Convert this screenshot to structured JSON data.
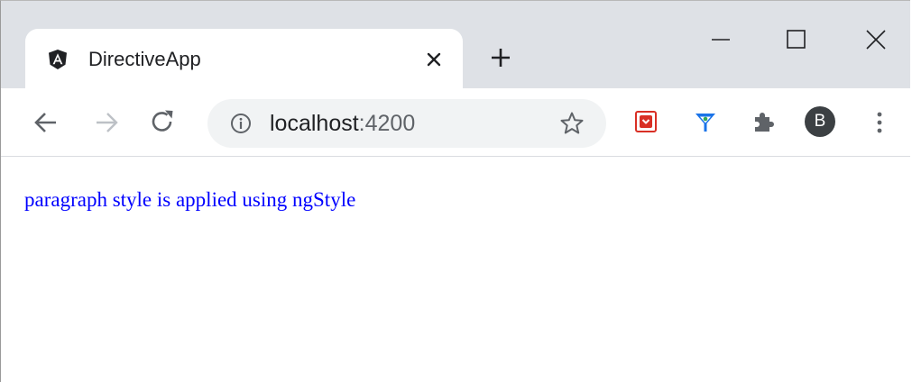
{
  "tab": {
    "title": "DirectiveApp",
    "favicon": "angular-icon"
  },
  "address_bar": {
    "host": "localhost",
    "port": ":4200"
  },
  "profile": {
    "initial": "B"
  },
  "page": {
    "paragraph": "paragraph style is applied using ngStyle",
    "paragraph_color": "#0000ff"
  },
  "colors": {
    "tabstrip_bg": "#dee1e6",
    "omnibox_bg": "#f1f3f4",
    "icon_gray": "#5f6368"
  }
}
